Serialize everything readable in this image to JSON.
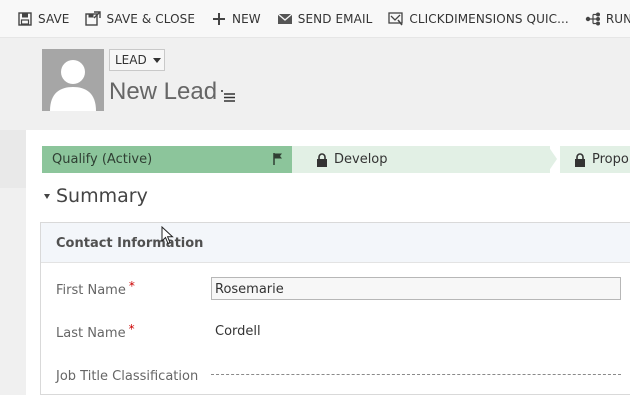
{
  "command_bar": {
    "items": [
      {
        "label": "SAVE",
        "icon": "save-icon"
      },
      {
        "label": "SAVE & CLOSE",
        "icon": "save-close-icon"
      },
      {
        "label": "NEW",
        "icon": "plus-icon"
      },
      {
        "label": "SEND EMAIL",
        "icon": "email-icon"
      },
      {
        "label": "CLICKDIMENSIONS QUIC...",
        "icon": "clickdimensions-icon"
      },
      {
        "label": "RUN CAM",
        "icon": "workflow-icon"
      }
    ]
  },
  "header": {
    "entity_label": "LEAD",
    "record_title": "New Lead"
  },
  "process": {
    "stages": [
      {
        "label": "Qualify (Active)"
      },
      {
        "label": "Develop"
      },
      {
        "label": "Propo"
      }
    ]
  },
  "summary": {
    "title": "Summary"
  },
  "section": {
    "title": "Contact Information",
    "fields": [
      {
        "label": "First Name",
        "required_mark": "*",
        "value": "Rosemarie"
      },
      {
        "label": "Last Name",
        "required_mark": "*",
        "value": "Cordell"
      },
      {
        "label": "Job Title Classification",
        "value": ""
      }
    ]
  },
  "colors": {
    "active_stage": "#8cc59b",
    "inactive_stage": "#e2f0e5",
    "required": "#cc0000"
  }
}
